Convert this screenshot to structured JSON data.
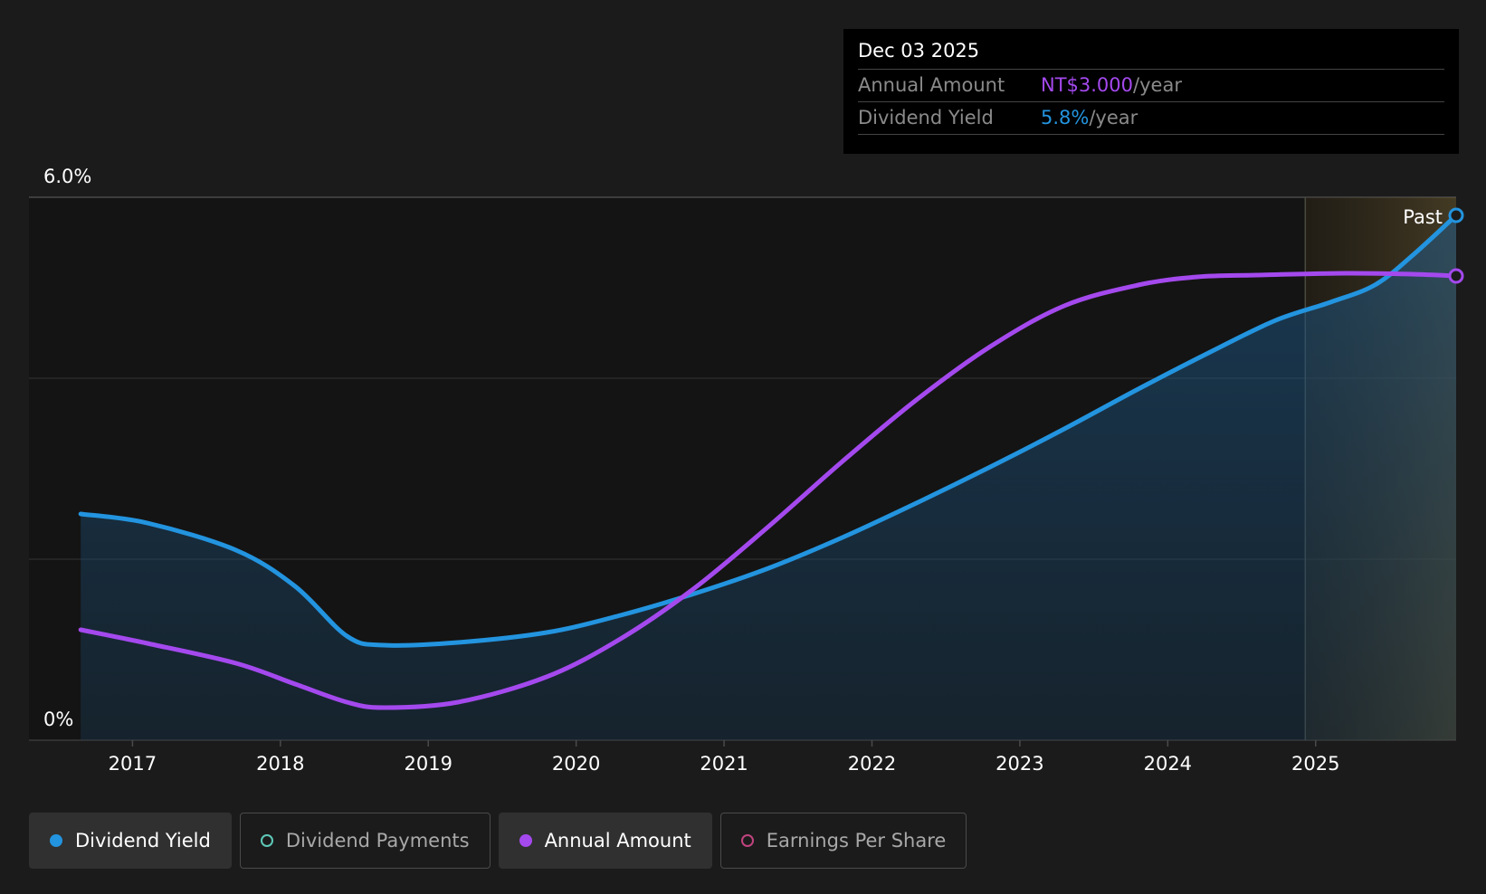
{
  "colors": {
    "background": "#1b1b1b",
    "dividend_yield": "#2394df",
    "annual_amount": "#a449ee",
    "dividend_payments": "#5ec9b8",
    "earnings_per_share": "#c0437e"
  },
  "tooltip": {
    "date": "Dec 03 2025",
    "rows": [
      {
        "label": "Annual Amount",
        "value": "NT$3.000",
        "unit": "/year"
      },
      {
        "label": "Dividend Yield",
        "value": "5.8%",
        "unit": "/year"
      }
    ]
  },
  "legend": [
    {
      "label": "Dividend Yield",
      "active": true,
      "filled": true,
      "color": "#2394df"
    },
    {
      "label": "Dividend Payments",
      "active": false,
      "filled": false,
      "color": "#5ec9b8"
    },
    {
      "label": "Annual Amount",
      "active": true,
      "filled": true,
      "color": "#a449ee"
    },
    {
      "label": "Earnings Per Share",
      "active": false,
      "filled": false,
      "color": "#c0437e"
    }
  ],
  "chart_data": {
    "type": "line",
    "x_ticks": [
      "2017",
      "2018",
      "2019",
      "2020",
      "2021",
      "2022",
      "2023",
      "2024",
      "2025"
    ],
    "y_tick_labels": [
      "6.0%",
      "0%"
    ],
    "ylim": [
      0,
      6
    ],
    "xlim": [
      2016.3,
      2025.95
    ],
    "past_region_start": 2024.93,
    "past_label": "Past",
    "grid": true,
    "series": [
      {
        "name": "Dividend Yield",
        "points": [
          [
            2016.65,
            2.5
          ],
          [
            2017.1,
            2.4
          ],
          [
            2017.7,
            2.1
          ],
          [
            2018.1,
            1.7
          ],
          [
            2018.45,
            1.15
          ],
          [
            2018.7,
            1.05
          ],
          [
            2019.2,
            1.08
          ],
          [
            2019.8,
            1.19
          ],
          [
            2020.3,
            1.38
          ],
          [
            2020.8,
            1.62
          ],
          [
            2021.3,
            1.9
          ],
          [
            2021.8,
            2.24
          ],
          [
            2022.3,
            2.62
          ],
          [
            2022.8,
            3.02
          ],
          [
            2023.3,
            3.44
          ],
          [
            2023.8,
            3.88
          ],
          [
            2024.3,
            4.3
          ],
          [
            2024.73,
            4.64
          ],
          [
            2025.1,
            4.84
          ],
          [
            2025.4,
            5.03
          ],
          [
            2025.65,
            5.35
          ],
          [
            2025.95,
            5.8
          ]
        ]
      },
      {
        "name": "Annual Amount",
        "points": [
          [
            2016.65,
            1.22
          ],
          [
            2017.1,
            1.07
          ],
          [
            2017.7,
            0.85
          ],
          [
            2018.1,
            0.62
          ],
          [
            2018.45,
            0.42
          ],
          [
            2018.7,
            0.36
          ],
          [
            2019.2,
            0.42
          ],
          [
            2019.8,
            0.7
          ],
          [
            2020.3,
            1.12
          ],
          [
            2020.8,
            1.68
          ],
          [
            2021.3,
            2.36
          ],
          [
            2021.8,
            3.08
          ],
          [
            2022.3,
            3.76
          ],
          [
            2022.8,
            4.35
          ],
          [
            2023.3,
            4.8
          ],
          [
            2023.8,
            5.03
          ],
          [
            2024.2,
            5.12
          ],
          [
            2024.6,
            5.14
          ],
          [
            2025.2,
            5.16
          ],
          [
            2025.65,
            5.15
          ],
          [
            2025.95,
            5.13
          ]
        ]
      }
    ]
  }
}
